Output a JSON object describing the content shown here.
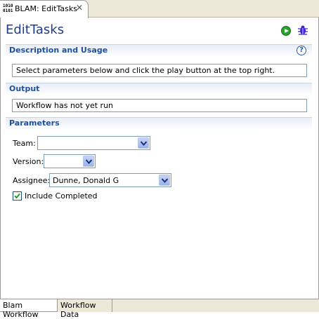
{
  "editor_tab": {
    "title": "BLAM: EditTasks",
    "icon_text": "1010\n0101"
  },
  "form": {
    "title": "EditTasks"
  },
  "toolbar": {
    "run_icon": "play-icon",
    "debug_icon": "bug-icon"
  },
  "sections": {
    "description": {
      "header": "Description and Usage",
      "text": "Select parameters below and click the play button at the top right."
    },
    "output": {
      "header": "Output",
      "text": "Workflow has not yet run"
    },
    "parameters": {
      "header": "Parameters",
      "team_label": "Team:",
      "team_value": "",
      "version_label": "Version:",
      "version_value": "",
      "assignee_label": "Assignee:",
      "assignee_value": "Dunne, Donald G",
      "include_completed_label": "Include Completed",
      "include_completed_checked": true
    }
  },
  "bottom_tabs": {
    "blam_workflow": "Blam Workflow",
    "workflow_data": "Workflow Data"
  },
  "colors": {
    "title": "#1f3b8f",
    "section_header": "#1f4fa3",
    "run": "#27a22f",
    "debug": "#3a22d8"
  }
}
